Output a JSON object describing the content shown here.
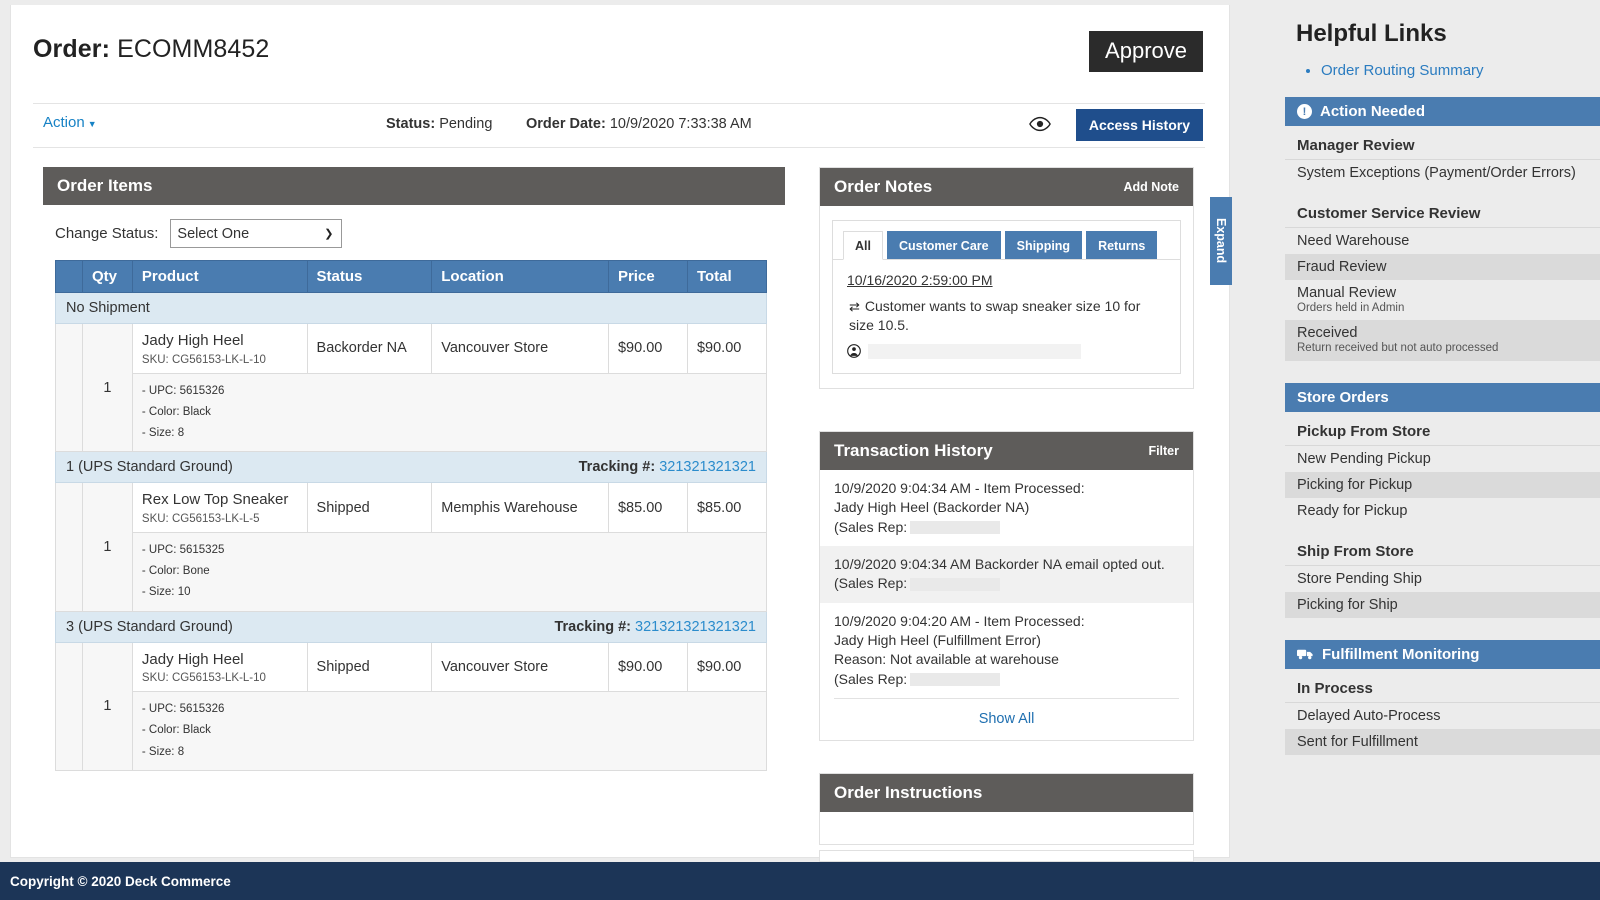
{
  "order": {
    "title_label": "Order:",
    "number": "ECOMM8452",
    "approve_label": "Approve",
    "action_label": "Action",
    "status_label": "Status:",
    "status_value": "Pending",
    "order_date_label": "Order Date:",
    "order_date_value": "10/9/2020 7:33:38 AM",
    "access_history_label": "Access History"
  },
  "order_items": {
    "title": "Order Items",
    "change_status_label": "Change Status:",
    "select_value": "Select One",
    "columns": [
      "",
      "Qty",
      "Product",
      "Status",
      "Location",
      "Price",
      "Total"
    ],
    "groups": [
      {
        "group_label": "No Shipment",
        "tracking_label": "",
        "tracking_number": "",
        "rows": [
          {
            "qty": "1",
            "product": "Jady High Heel",
            "sku": "SKU: CG56153-LK-L-10",
            "status": "Backorder NA",
            "location": "Vancouver Store",
            "price": "$90.00",
            "total": "$90.00",
            "details": [
              "- UPC: 5615326",
              "- Color: Black",
              "- Size: 8"
            ]
          }
        ]
      },
      {
        "group_label": "1 (UPS Standard Ground)",
        "tracking_label": "Tracking #:",
        "tracking_number": "321321321321",
        "rows": [
          {
            "qty": "1",
            "product": "Rex Low Top Sneaker",
            "sku": "SKU: CG56153-LK-L-5",
            "status": "Shipped",
            "location": "Memphis Warehouse",
            "price": "$85.00",
            "total": "$85.00",
            "details": [
              "- UPC: 5615325",
              "- Color: Bone",
              "- Size: 10"
            ]
          }
        ]
      },
      {
        "group_label": "3 (UPS Standard Ground)",
        "tracking_label": "Tracking #:",
        "tracking_number": "321321321321321",
        "rows": [
          {
            "qty": "1",
            "product": "Jady High Heel",
            "sku": "SKU: CG56153-LK-L-10",
            "status": "Shipped",
            "location": "Vancouver Store",
            "price": "$90.00",
            "total": "$90.00",
            "details": [
              "- UPC: 5615326",
              "- Color: Black",
              "- Size: 8"
            ]
          }
        ]
      }
    ]
  },
  "order_notes": {
    "title": "Order Notes",
    "add_note_label": "Add Note",
    "tabs": [
      {
        "label": "All",
        "active": true
      },
      {
        "label": "Customer Care",
        "active": false
      },
      {
        "label": "Shipping",
        "active": false
      },
      {
        "label": "Returns",
        "active": false
      }
    ],
    "entries": [
      {
        "date": "10/16/2020 2:59:00 PM",
        "text": "Customer wants to swap sneaker size 10 for size 10.5.",
        "author": ""
      }
    ]
  },
  "transaction_history": {
    "title": "Transaction History",
    "filter_label": "Filter",
    "entries": [
      {
        "lines": [
          "10/9/2020 9:04:34 AM - Item Processed:",
          "Jady High Heel (Backorder NA)",
          "(Sales Rep:"
        ],
        "redacted": true
      },
      {
        "lines": [
          "10/9/2020 9:04:34 AM Backorder NA email opted out.",
          "(Sales Rep:"
        ],
        "redacted": true
      },
      {
        "lines": [
          "10/9/2020 9:04:20 AM - Item Processed:",
          "Jady High Heel (Fulfillment Error)",
          "Reason: Not available at warehouse",
          "(Sales Rep:"
        ],
        "redacted": true
      }
    ],
    "show_all_label": "Show All"
  },
  "order_instructions": {
    "title": "Order Instructions"
  },
  "expand_tab": {
    "label": "Expand"
  },
  "sidebar": {
    "helpful_links_title": "Helpful Links",
    "links": [
      "Order Routing Summary"
    ],
    "sections": [
      {
        "header": "Action Needed",
        "icon": "alert-icon",
        "groups": [
          {
            "title": "Manager Review",
            "items": [
              {
                "label": "System Exceptions (Payment/Order Errors)",
                "sub": "",
                "shaded": false
              }
            ]
          },
          {
            "title": "Customer Service Review",
            "items": [
              {
                "label": "Need Warehouse",
                "sub": "",
                "shaded": false
              },
              {
                "label": "Fraud Review",
                "sub": "",
                "shaded": true
              },
              {
                "label": "Manual Review",
                "sub": "Orders held in Admin",
                "shaded": false
              },
              {
                "label": "Received",
                "sub": "Return received but not auto processed",
                "shaded": true
              }
            ]
          }
        ]
      },
      {
        "header": "Store Orders",
        "icon": "",
        "groups": [
          {
            "title": "Pickup From Store",
            "items": [
              {
                "label": "New Pending Pickup",
                "sub": "",
                "shaded": false
              },
              {
                "label": "Picking for Pickup",
                "sub": "",
                "shaded": true
              },
              {
                "label": "Ready for Pickup",
                "sub": "",
                "shaded": false
              }
            ]
          },
          {
            "title": "Ship From Store",
            "items": [
              {
                "label": "Store Pending Ship",
                "sub": "",
                "shaded": false
              },
              {
                "label": "Picking for Ship",
                "sub": "",
                "shaded": true
              }
            ]
          }
        ]
      },
      {
        "header": "Fulfillment Monitoring",
        "icon": "truck-icon",
        "groups": [
          {
            "title": "In Process",
            "items": [
              {
                "label": "Delayed Auto-Process",
                "sub": "",
                "shaded": false
              },
              {
                "label": "Sent for Fulfillment",
                "sub": "",
                "shaded": true
              }
            ]
          }
        ]
      }
    ]
  },
  "footer": {
    "text": "Copyright © 2020 Deck Commerce"
  },
  "colors": {
    "accent_blue": "#4a7cb0",
    "dark_blue": "#1f4e8c",
    "card_head_gray": "#5e5c5a",
    "footer_navy": "#1c3557",
    "link_blue": "#2b7cc0",
    "approve_black": "#2b2b2b"
  }
}
